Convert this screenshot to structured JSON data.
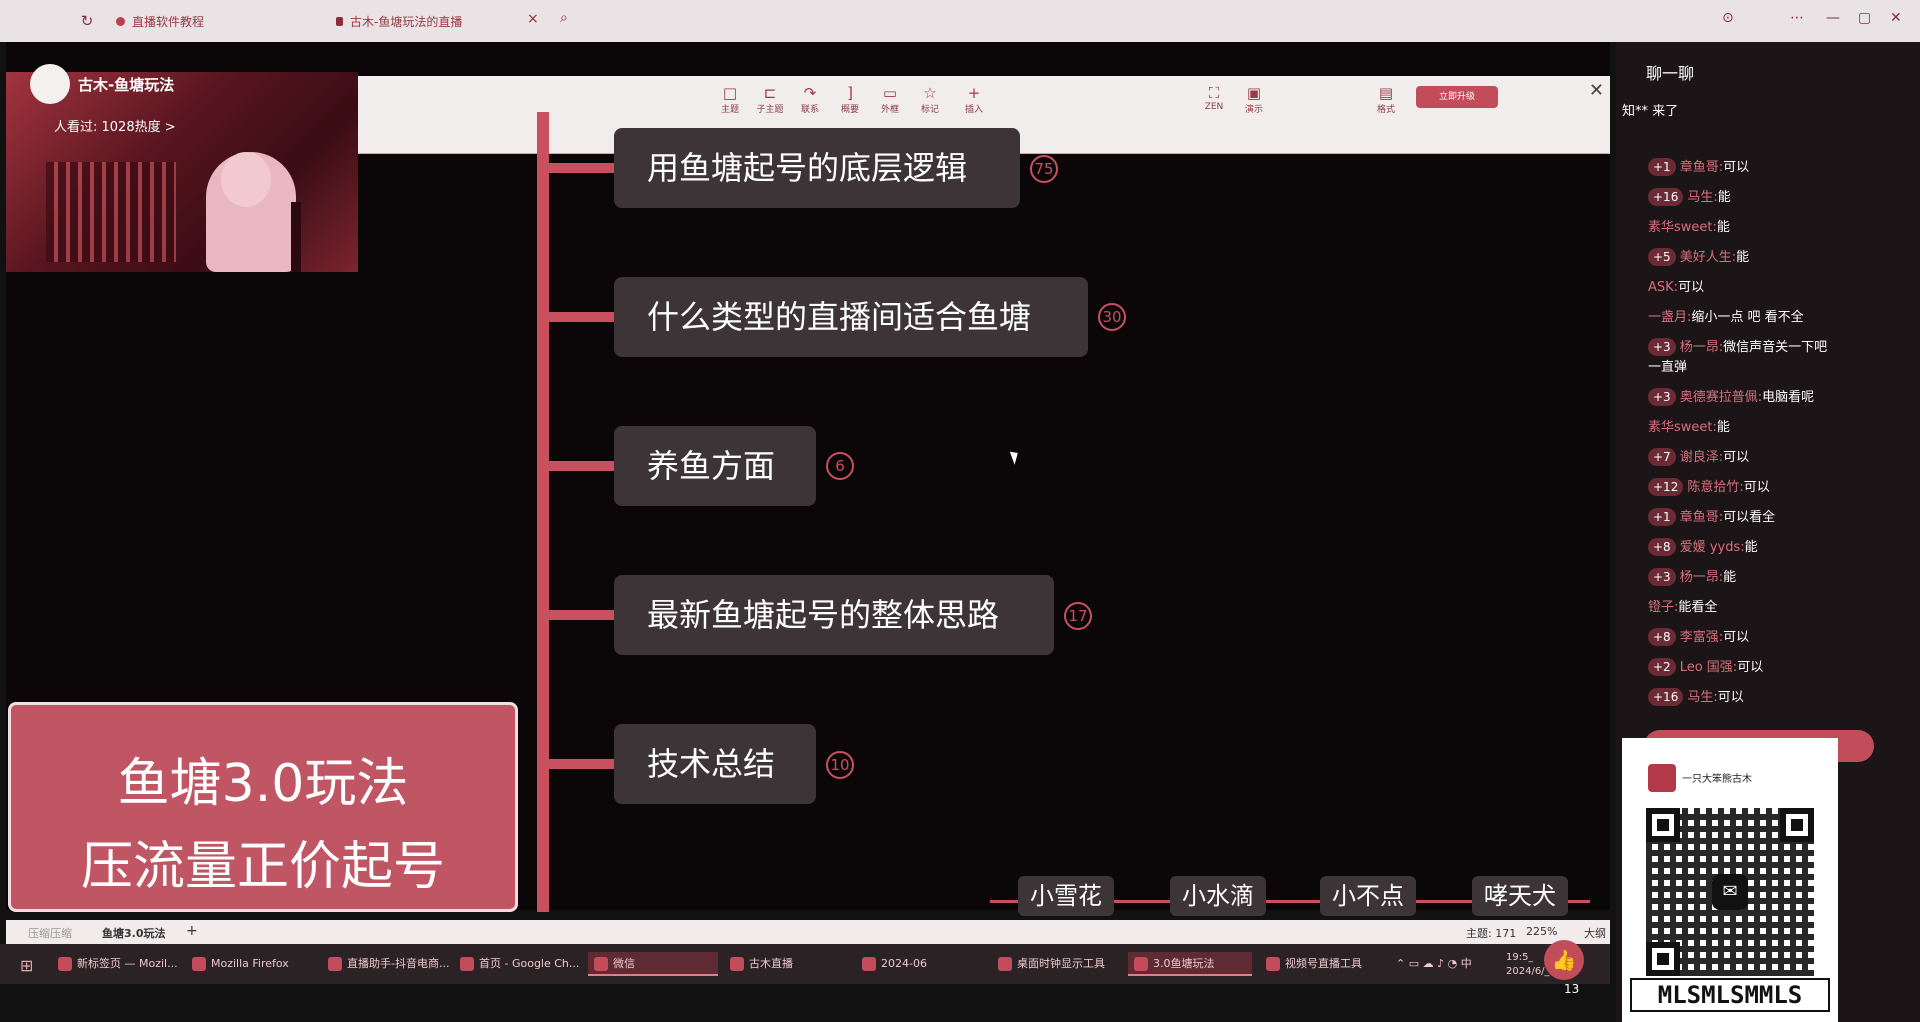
{
  "browser": {
    "tabs": [
      {
        "label": "直播软件教程"
      },
      {
        "label": "古木-鱼塘玩法的直播"
      }
    ],
    "close_glyph": "×",
    "right_icons": [
      "download-icon",
      "more-icon",
      "minimize-icon",
      "maximize-icon",
      "close-icon"
    ]
  },
  "live": {
    "streamer_name": "古木-鱼塘玩法",
    "viewers_text": "人看过: 1028热度 >"
  },
  "toolbar": {
    "buttons": [
      {
        "label": "主题",
        "icon": "□"
      },
      {
        "label": "子主题",
        "icon": "⊏"
      },
      {
        "label": "联系",
        "icon": "↷"
      },
      {
        "label": "概要",
        "icon": "]"
      },
      {
        "label": "外框",
        "icon": "▭"
      },
      {
        "label": "标记",
        "icon": "☆"
      },
      {
        "label": "插入",
        "icon": "+"
      },
      {
        "label": "ZEN",
        "icon": "⛶"
      },
      {
        "label": "演示",
        "icon": "▣"
      },
      {
        "label": "格式",
        "icon": "▤"
      }
    ],
    "upgrade_label": "立即升级",
    "close_glyph": "✕"
  },
  "mindmap": {
    "nodes": [
      {
        "label": "用鱼塘起号的底层逻辑",
        "count": "75"
      },
      {
        "label": "什么类型的直播间适合鱼塘",
        "count": "30"
      },
      {
        "label": "养鱼方面",
        "count": "6"
      },
      {
        "label": "最新鱼塘起号的整体思路",
        "count": "17"
      },
      {
        "label": "技术总结",
        "count": "10"
      }
    ],
    "sub_nodes": [
      "小雪花",
      "小水滴",
      "小不点",
      "哮天犬"
    ]
  },
  "title_card": {
    "line1": "鱼塘3.0玩法",
    "line2": "压流量正价起号"
  },
  "app_tabs": {
    "tab1": "压缩压缩",
    "tab2": "鱼塘3.0玩法",
    "add": "+",
    "status": "主题: 171",
    "zoom": "225%",
    "outline": "大纲"
  },
  "taskbar": {
    "items": [
      "新标签页 — Mozil...",
      "Mozilla Firefox",
      "直播助手-抖音电商...",
      "首页 - Google Ch...",
      "微信",
      "古木直播",
      "2024-06",
      "桌面时钟显示工具",
      "3.0鱼塘玩法",
      "视频号直播工具"
    ],
    "time": "19:5_",
    "date": "2024/6/_"
  },
  "chat": {
    "title": "聊一聊",
    "join_text": "知** 来了",
    "messages": [
      {
        "level": "1",
        "user": "章鱼哥:",
        "text": "可以"
      },
      {
        "level": "16",
        "user": "马生:",
        "text": "能"
      },
      {
        "level": "",
        "user": "素华sweet:",
        "text": "能"
      },
      {
        "level": "5",
        "user": "美好人生:",
        "text": "能"
      },
      {
        "level": "",
        "user": "ASK:",
        "text": "可以"
      },
      {
        "level": "",
        "user": "一盏月:",
        "text": "缩小一点 吧 看不全"
      },
      {
        "level": "3",
        "user": "杨一昂:",
        "text": "微信声音关一下吧"
      },
      {
        "level": "",
        "user": "",
        "text": "一直弹"
      },
      {
        "level": "3",
        "user": "奥德赛拉普佩:",
        "text": "电脑看呢"
      },
      {
        "level": "",
        "user": "素华sweet:",
        "text": "能"
      },
      {
        "level": "7",
        "user": "谢良泽:",
        "text": "可以"
      },
      {
        "level": "12",
        "user": "陈意拾竹:",
        "text": "可以"
      },
      {
        "level": "1",
        "user": "章鱼哥:",
        "text": "可以看全"
      },
      {
        "level": "8",
        "user": "爱媛 yyds:",
        "text": "能"
      },
      {
        "level": "3",
        "user": "杨一昂:",
        "text": "能"
      },
      {
        "level": "",
        "user": "镫子:",
        "text": "能看全"
      },
      {
        "level": "8",
        "user": "李富强:",
        "text": "可以"
      },
      {
        "level": "2",
        "user": "Leo 国强:",
        "text": "可以"
      },
      {
        "level": "16",
        "user": "马生:",
        "text": "可以"
      }
    ],
    "like_count": "13"
  },
  "qr": {
    "name": "一只大笨熊古木",
    "footer": "MLSMLSMMLS"
  }
}
